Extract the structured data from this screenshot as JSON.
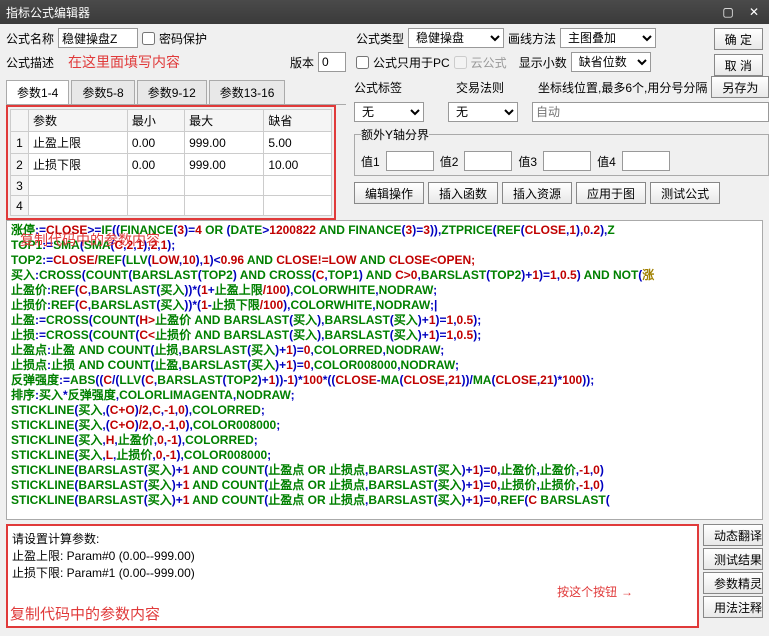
{
  "title": "指标公式编辑器",
  "form": {
    "name_lbl": "公式名称",
    "name_val": "稳健操盘Z",
    "pwd_lbl": "密码保护",
    "desc_lbl": "公式描述",
    "desc_hint": "在这里面填写内容",
    "ver_lbl": "版本",
    "ver_val": "0",
    "type_lbl": "公式类型",
    "type_val": "稳健操盘",
    "draw_lbl": "画线方法",
    "draw_val": "主图叠加",
    "pc_lbl": "公式只用于PC",
    "cloud_lbl": "云公式",
    "dec_lbl": "显示小数",
    "decdef_lbl": "缺省位数"
  },
  "btns": {
    "ok": "确 定",
    "cancel": "取 消",
    "saveas": "另存为"
  },
  "tabs": [
    "参数1-4",
    "参数5-8",
    "参数9-12",
    "参数13-16"
  ],
  "param_hdr": [
    "参数",
    "最小",
    "最大",
    "缺省"
  ],
  "params": [
    {
      "n": "1",
      "name": "止盈上限",
      "min": "0.00",
      "max": "999.00",
      "def": "5.00"
    },
    {
      "n": "2",
      "name": "止损下限",
      "min": "0.00",
      "max": "999.00",
      "def": "10.00"
    },
    {
      "n": "3",
      "name": "",
      "min": "",
      "max": "",
      "def": ""
    },
    {
      "n": "4",
      "name": "",
      "min": "",
      "max": "",
      "def": ""
    }
  ],
  "annot_params": "复制代码中的参数内容",
  "right": {
    "tag_lbl": "公式标签",
    "law_lbl": "交易法则",
    "coord_lbl": "坐标线位置,最多6个,用分号分隔",
    "tag_val": "无",
    "law_val": "无",
    "coord_ph": "自动",
    "extray_lbl": "额外Y轴分界",
    "v1": "值1",
    "v2": "值2",
    "v3": "值3",
    "v4": "值4"
  },
  "toolbar": [
    "编辑操作",
    "插入函数",
    "插入资源",
    "应用于图",
    "测试公式"
  ],
  "code_lines": [
    [
      [
        "g",
        "涨停"
      ],
      [
        "b",
        ":="
      ],
      [
        "r",
        "CLOSE"
      ],
      [
        "b",
        ">="
      ],
      [
        "g",
        "IF"
      ],
      [
        "b",
        "(("
      ],
      [
        "g",
        "FINANCE"
      ],
      [
        "b",
        "("
      ],
      [
        "r",
        "3"
      ],
      [
        "b",
        ")="
      ],
      [
        "r",
        "4 "
      ],
      [
        "g",
        "OR"
      ],
      [
        "b",
        " ("
      ],
      [
        "g",
        "DATE"
      ],
      [
        "b",
        ">"
      ],
      [
        "r",
        "1200822 "
      ],
      [
        "g",
        "AND FINANCE"
      ],
      [
        "b",
        "("
      ],
      [
        "r",
        "3"
      ],
      [
        "b",
        ")="
      ],
      [
        "r",
        "3"
      ],
      [
        "b",
        "))"
      ],
      [
        "b",
        ","
      ],
      [
        "g",
        "ZTPRICE"
      ],
      [
        "b",
        "("
      ],
      [
        "g",
        "REF"
      ],
      [
        "b",
        "("
      ],
      [
        "r",
        "CLOSE"
      ],
      [
        "b",
        ","
      ],
      [
        "r",
        "1"
      ],
      [
        "b",
        "),"
      ],
      [
        "r",
        "0"
      ],
      [
        "b",
        "."
      ],
      [
        "r",
        "2"
      ],
      [
        "b",
        "),"
      ],
      [
        "g",
        "Z"
      ]
    ],
    [
      [
        "g",
        "TOP1"
      ],
      [
        "b",
        ":="
      ],
      [
        "g",
        "SMA"
      ],
      [
        "b",
        "("
      ],
      [
        "g",
        "SMA"
      ],
      [
        "b",
        "("
      ],
      [
        "r",
        "C"
      ],
      [
        "b",
        ","
      ],
      [
        "r",
        "2"
      ],
      [
        "b",
        ","
      ],
      [
        "r",
        "1"
      ],
      [
        "b",
        "),"
      ],
      [
        "r",
        "2"
      ],
      [
        "b",
        ","
      ],
      [
        "r",
        "1"
      ],
      [
        "b",
        ");"
      ]
    ],
    [
      [
        "g",
        "TOP2"
      ],
      [
        "b",
        ":="
      ],
      [
        "r",
        "CLOSE/"
      ],
      [
        "g",
        "REF"
      ],
      [
        "b",
        "("
      ],
      [
        "g",
        "LLV"
      ],
      [
        "b",
        "("
      ],
      [
        "r",
        "LOW"
      ],
      [
        "b",
        ","
      ],
      [
        "r",
        "10"
      ],
      [
        "b",
        "),"
      ],
      [
        "r",
        "1"
      ],
      [
        "b",
        ")<"
      ],
      [
        "r",
        "0.96 "
      ],
      [
        "g",
        "AND"
      ],
      [
        "r",
        " CLOSE!=LOW "
      ],
      [
        "g",
        "AND "
      ],
      [
        "r",
        "CLOSE<OPEN;"
      ]
    ],
    [
      [
        "g",
        "买入"
      ],
      [
        "b",
        ":"
      ],
      [
        "g",
        "CROSS"
      ],
      [
        "b",
        "("
      ],
      [
        "g",
        "COUNT"
      ],
      [
        "b",
        "("
      ],
      [
        "g",
        "BARSLAST"
      ],
      [
        "b",
        "("
      ],
      [
        "g",
        "TOP2"
      ],
      [
        "b",
        ") "
      ],
      [
        "g",
        "AND CROSS"
      ],
      [
        "b",
        "("
      ],
      [
        "r",
        "C"
      ],
      [
        "b",
        ","
      ],
      [
        "g",
        "TOP1"
      ],
      [
        "b",
        ") "
      ],
      [
        "g",
        "AND "
      ],
      [
        "r",
        "C>0"
      ],
      [
        "b",
        ","
      ],
      [
        "g",
        "BARSLAST"
      ],
      [
        "b",
        "("
      ],
      [
        "g",
        "TOP2"
      ],
      [
        "b",
        ")+"
      ],
      [
        "r",
        "1"
      ],
      [
        "b",
        ")="
      ],
      [
        "r",
        "1"
      ],
      [
        "b",
        ","
      ],
      [
        "r",
        "0.5"
      ],
      [
        "b",
        ") "
      ],
      [
        "g",
        "AND NOT"
      ],
      [
        "b",
        "("
      ],
      [
        "y",
        "涨"
      ]
    ],
    [
      [
        "g",
        "止盈价"
      ],
      [
        "b",
        ":"
      ],
      [
        "g",
        "REF"
      ],
      [
        "b",
        "("
      ],
      [
        "r",
        "C"
      ],
      [
        "b",
        ","
      ],
      [
        "g",
        "BARSLAST"
      ],
      [
        "b",
        "("
      ],
      [
        "g",
        "买入"
      ],
      [
        "b",
        "))*("
      ],
      [
        "r",
        "1"
      ],
      [
        "b",
        "+"
      ],
      [
        "g",
        "止盈上限"
      ],
      [
        "r",
        "/100"
      ],
      [
        "b",
        ")"
      ],
      [
        "b",
        ","
      ],
      [
        "g",
        "COLORWHITE"
      ],
      [
        "b",
        ","
      ],
      [
        "g",
        "NODRAW"
      ],
      [
        "b",
        ";"
      ]
    ],
    [
      [
        "g",
        "止损价"
      ],
      [
        "b",
        ":"
      ],
      [
        "g",
        "REF"
      ],
      [
        "b",
        "("
      ],
      [
        "r",
        "C"
      ],
      [
        "b",
        ","
      ],
      [
        "g",
        "BARSLAST"
      ],
      [
        "b",
        "("
      ],
      [
        "g",
        "买入"
      ],
      [
        "b",
        "))*("
      ],
      [
        "r",
        "1"
      ],
      [
        "b",
        "-"
      ],
      [
        "g",
        "止损下限"
      ],
      [
        "r",
        "/100"
      ],
      [
        "b",
        ")"
      ],
      [
        "b",
        ","
      ],
      [
        "g",
        "COLORWHITE"
      ],
      [
        "b",
        ","
      ],
      [
        "g",
        "NODRAW"
      ],
      [
        "b",
        ";|"
      ]
    ],
    [
      [
        "g",
        "止盈"
      ],
      [
        "b",
        ":="
      ],
      [
        "g",
        "CROSS"
      ],
      [
        "b",
        "("
      ],
      [
        "g",
        "COUNT"
      ],
      [
        "b",
        "("
      ],
      [
        "r",
        "H>"
      ],
      [
        "g",
        "止盈价 AND BARSLAST"
      ],
      [
        "b",
        "("
      ],
      [
        "g",
        "买入"
      ],
      [
        "b",
        "),"
      ],
      [
        "g",
        "BARSLAST"
      ],
      [
        "b",
        "("
      ],
      [
        "g",
        "买入"
      ],
      [
        "b",
        ")+"
      ],
      [
        "r",
        "1"
      ],
      [
        "b",
        ")="
      ],
      [
        "r",
        "1"
      ],
      [
        "b",
        ","
      ],
      [
        "r",
        "0.5"
      ],
      [
        "b",
        ");"
      ]
    ],
    [
      [
        "g",
        "止损"
      ],
      [
        "b",
        ":="
      ],
      [
        "g",
        "CROSS"
      ],
      [
        "b",
        "("
      ],
      [
        "g",
        "COUNT"
      ],
      [
        "b",
        "("
      ],
      [
        "r",
        "C<"
      ],
      [
        "g",
        "止损价 AND BARSLAST"
      ],
      [
        "b",
        "("
      ],
      [
        "g",
        "买入"
      ],
      [
        "b",
        "),"
      ],
      [
        "g",
        "BARSLAST"
      ],
      [
        "b",
        "("
      ],
      [
        "g",
        "买入"
      ],
      [
        "b",
        ")+"
      ],
      [
        "r",
        "1"
      ],
      [
        "b",
        ")="
      ],
      [
        "r",
        "1"
      ],
      [
        "b",
        ","
      ],
      [
        "r",
        "0.5"
      ],
      [
        "b",
        ");"
      ]
    ],
    [
      [
        "g",
        "止盈点"
      ],
      [
        "b",
        ":"
      ],
      [
        "g",
        "止盈 AND COUNT"
      ],
      [
        "b",
        "("
      ],
      [
        "g",
        "止损"
      ],
      [
        "b",
        ","
      ],
      [
        "g",
        "BARSLAST"
      ],
      [
        "b",
        "("
      ],
      [
        "g",
        "买入"
      ],
      [
        "b",
        ")+"
      ],
      [
        "r",
        "1"
      ],
      [
        "b",
        ")="
      ],
      [
        "r",
        "0"
      ],
      [
        "b",
        ","
      ],
      [
        "g",
        "COLORRED"
      ],
      [
        "b",
        ","
      ],
      [
        "g",
        "NODRAW"
      ],
      [
        "b",
        ";"
      ]
    ],
    [
      [
        "g",
        "止损点"
      ],
      [
        "b",
        ":"
      ],
      [
        "g",
        "止损 AND COUNT"
      ],
      [
        "b",
        "("
      ],
      [
        "g",
        "止盈"
      ],
      [
        "b",
        ","
      ],
      [
        "g",
        "BARSLAST"
      ],
      [
        "b",
        "("
      ],
      [
        "g",
        "买入"
      ],
      [
        "b",
        ")+"
      ],
      [
        "r",
        "1"
      ],
      [
        "b",
        ")="
      ],
      [
        "r",
        "0"
      ],
      [
        "b",
        ","
      ],
      [
        "g",
        "COLOR008000"
      ],
      [
        "b",
        ","
      ],
      [
        "g",
        "NODRAW"
      ],
      [
        "b",
        ";"
      ]
    ],
    [
      [
        "g",
        "反弹强度"
      ],
      [
        "b",
        ":="
      ],
      [
        "g",
        "ABS"
      ],
      [
        "b",
        "(("
      ],
      [
        "r",
        "C"
      ],
      [
        "b",
        "/("
      ],
      [
        "g",
        "LLV"
      ],
      [
        "b",
        "("
      ],
      [
        "r",
        "C"
      ],
      [
        "b",
        ","
      ],
      [
        "g",
        "BARSLAST"
      ],
      [
        "b",
        "("
      ],
      [
        "g",
        "TOP2"
      ],
      [
        "b",
        ")+"
      ],
      [
        "r",
        "1"
      ],
      [
        "b",
        "))-"
      ],
      [
        "r",
        "1"
      ],
      [
        "b",
        ")*"
      ],
      [
        "r",
        "100"
      ],
      [
        "b",
        "*(("
      ],
      [
        "r",
        "CLOSE"
      ],
      [
        "b",
        "-"
      ],
      [
        "g",
        "MA"
      ],
      [
        "b",
        "("
      ],
      [
        "r",
        "CLOSE"
      ],
      [
        "b",
        ","
      ],
      [
        "r",
        "21"
      ],
      [
        "b",
        "))/"
      ],
      [
        "g",
        "MA"
      ],
      [
        "b",
        "("
      ],
      [
        "r",
        "CLOSE"
      ],
      [
        "b",
        ","
      ],
      [
        "r",
        "21"
      ],
      [
        "b",
        ")*"
      ],
      [
        "r",
        "100"
      ],
      [
        "b",
        "));"
      ]
    ],
    [
      [
        "g",
        "排序"
      ],
      [
        "b",
        ":"
      ],
      [
        "g",
        "买入"
      ],
      [
        "b",
        "*"
      ],
      [
        "g",
        "反弹强度"
      ],
      [
        "b",
        ","
      ],
      [
        "g",
        "COLORLIMAGENTA"
      ],
      [
        "b",
        ","
      ],
      [
        "g",
        "NODRAW"
      ],
      [
        "b",
        ";"
      ]
    ],
    [
      [
        "g",
        "STICKLINE"
      ],
      [
        "b",
        "("
      ],
      [
        "g",
        "买入"
      ],
      [
        "b",
        ",("
      ],
      [
        "r",
        "C+O"
      ],
      [
        "b",
        ")"
      ],
      [
        "r",
        "/2"
      ],
      [
        "b",
        ","
      ],
      [
        "r",
        "C"
      ],
      [
        "b",
        ","
      ],
      [
        "r",
        "-1"
      ],
      [
        "b",
        ","
      ],
      [
        "r",
        "0"
      ],
      [
        "b",
        ")"
      ],
      [
        "b",
        ","
      ],
      [
        "g",
        "COLORRED"
      ],
      [
        "b",
        ";"
      ]
    ],
    [
      [
        "g",
        "STICKLINE"
      ],
      [
        "b",
        "("
      ],
      [
        "g",
        "买入"
      ],
      [
        "b",
        ",("
      ],
      [
        "r",
        "C+O"
      ],
      [
        "b",
        ")"
      ],
      [
        "r",
        "/2"
      ],
      [
        "b",
        ","
      ],
      [
        "r",
        "O"
      ],
      [
        "b",
        ","
      ],
      [
        "r",
        "-1"
      ],
      [
        "b",
        ","
      ],
      [
        "r",
        "0"
      ],
      [
        "b",
        ")"
      ],
      [
        "b",
        ","
      ],
      [
        "g",
        "COLOR008000"
      ],
      [
        "b",
        ";"
      ]
    ],
    [
      [
        "g",
        "STICKLINE"
      ],
      [
        "b",
        "("
      ],
      [
        "g",
        "买入"
      ],
      [
        "b",
        ","
      ],
      [
        "r",
        "H"
      ],
      [
        "b",
        ","
      ],
      [
        "g",
        "止盈价"
      ],
      [
        "b",
        ","
      ],
      [
        "r",
        "0"
      ],
      [
        "b",
        ","
      ],
      [
        "r",
        "-1"
      ],
      [
        "b",
        ")"
      ],
      [
        "b",
        ","
      ],
      [
        "g",
        "COLORRED"
      ],
      [
        "b",
        ";"
      ]
    ],
    [
      [
        "g",
        "STICKLINE"
      ],
      [
        "b",
        "("
      ],
      [
        "g",
        "买入"
      ],
      [
        "b",
        ","
      ],
      [
        "r",
        "L"
      ],
      [
        "b",
        ","
      ],
      [
        "g",
        "止损价"
      ],
      [
        "b",
        ","
      ],
      [
        "r",
        "0"
      ],
      [
        "b",
        ","
      ],
      [
        "r",
        "-1"
      ],
      [
        "b",
        ")"
      ],
      [
        "b",
        ","
      ],
      [
        "g",
        "COLOR008000"
      ],
      [
        "b",
        ";"
      ]
    ],
    [
      [
        "g",
        "STICKLINE"
      ],
      [
        "b",
        "("
      ],
      [
        "g",
        "BARSLAST"
      ],
      [
        "b",
        "("
      ],
      [
        "g",
        "买入"
      ],
      [
        "b",
        ")+"
      ],
      [
        "r",
        "1 "
      ],
      [
        "g",
        "AND COUNT"
      ],
      [
        "b",
        "("
      ],
      [
        "g",
        "止盈点 "
      ],
      [
        "g",
        "OR 止损点"
      ],
      [
        "b",
        ","
      ],
      [
        "g",
        "BARSLAST"
      ],
      [
        "b",
        "("
      ],
      [
        "g",
        "买入"
      ],
      [
        "b",
        ")+"
      ],
      [
        "r",
        "1"
      ],
      [
        "b",
        ")="
      ],
      [
        "r",
        "0"
      ],
      [
        "b",
        ","
      ],
      [
        "g",
        "止盈价"
      ],
      [
        "b",
        ","
      ],
      [
        "g",
        "止盈价"
      ],
      [
        "b",
        ","
      ],
      [
        "r",
        "-1"
      ],
      [
        "b",
        ","
      ],
      [
        "r",
        "0"
      ],
      [
        "b",
        ")"
      ]
    ],
    [
      [
        "g",
        "STICKLINE"
      ],
      [
        "b",
        "("
      ],
      [
        "g",
        "BARSLAST"
      ],
      [
        "b",
        "("
      ],
      [
        "g",
        "买入"
      ],
      [
        "b",
        ")+"
      ],
      [
        "r",
        "1 "
      ],
      [
        "g",
        "AND COUNT"
      ],
      [
        "b",
        "("
      ],
      [
        "g",
        "止盈点 "
      ],
      [
        "g",
        "OR 止损点"
      ],
      [
        "b",
        ","
      ],
      [
        "g",
        "BARSLAST"
      ],
      [
        "b",
        "("
      ],
      [
        "g",
        "买入"
      ],
      [
        "b",
        ")+"
      ],
      [
        "r",
        "1"
      ],
      [
        "b",
        ")="
      ],
      [
        "r",
        "0"
      ],
      [
        "b",
        ","
      ],
      [
        "g",
        "止损价"
      ],
      [
        "b",
        ","
      ],
      [
        "g",
        "止损价"
      ],
      [
        "b",
        ","
      ],
      [
        "r",
        "-1"
      ],
      [
        "b",
        ","
      ],
      [
        "r",
        "0"
      ],
      [
        "b",
        ")"
      ]
    ],
    [
      [
        "g",
        "STICKLINE"
      ],
      [
        "b",
        "("
      ],
      [
        "g",
        "BARSLAST"
      ],
      [
        "b",
        "("
      ],
      [
        "g",
        "买入"
      ],
      [
        "b",
        ")+"
      ],
      [
        "r",
        "1 "
      ],
      [
        "g",
        "AND COUNT"
      ],
      [
        "b",
        "("
      ],
      [
        "g",
        "止盈点 "
      ],
      [
        "g",
        "OR 止损点"
      ],
      [
        "b",
        ","
      ],
      [
        "g",
        "BARSLAST"
      ],
      [
        "b",
        "("
      ],
      [
        "g",
        "买入"
      ],
      [
        "b",
        ")+"
      ],
      [
        "r",
        "1"
      ],
      [
        "b",
        ")="
      ],
      [
        "r",
        "0"
      ],
      [
        "b",
        ","
      ],
      [
        "g",
        "REF"
      ],
      [
        "b",
        "("
      ],
      [
        "r",
        "C "
      ],
      [
        "g",
        "BARSLAST"
      ],
      [
        "b",
        "("
      ]
    ]
  ],
  "msgbox": {
    "l1": "请设置计算参数:",
    "l2": "止盈上限: Param#0 (0.00--999.00)",
    "l3": "止损下限: Param#1 (0.00--999.00)",
    "annot": "复制代码中的参数内容"
  },
  "sidebtns": [
    "动态翻译",
    "测试结果",
    "参数精灵",
    "用法注释"
  ],
  "annot_btn": "按这个按钮"
}
